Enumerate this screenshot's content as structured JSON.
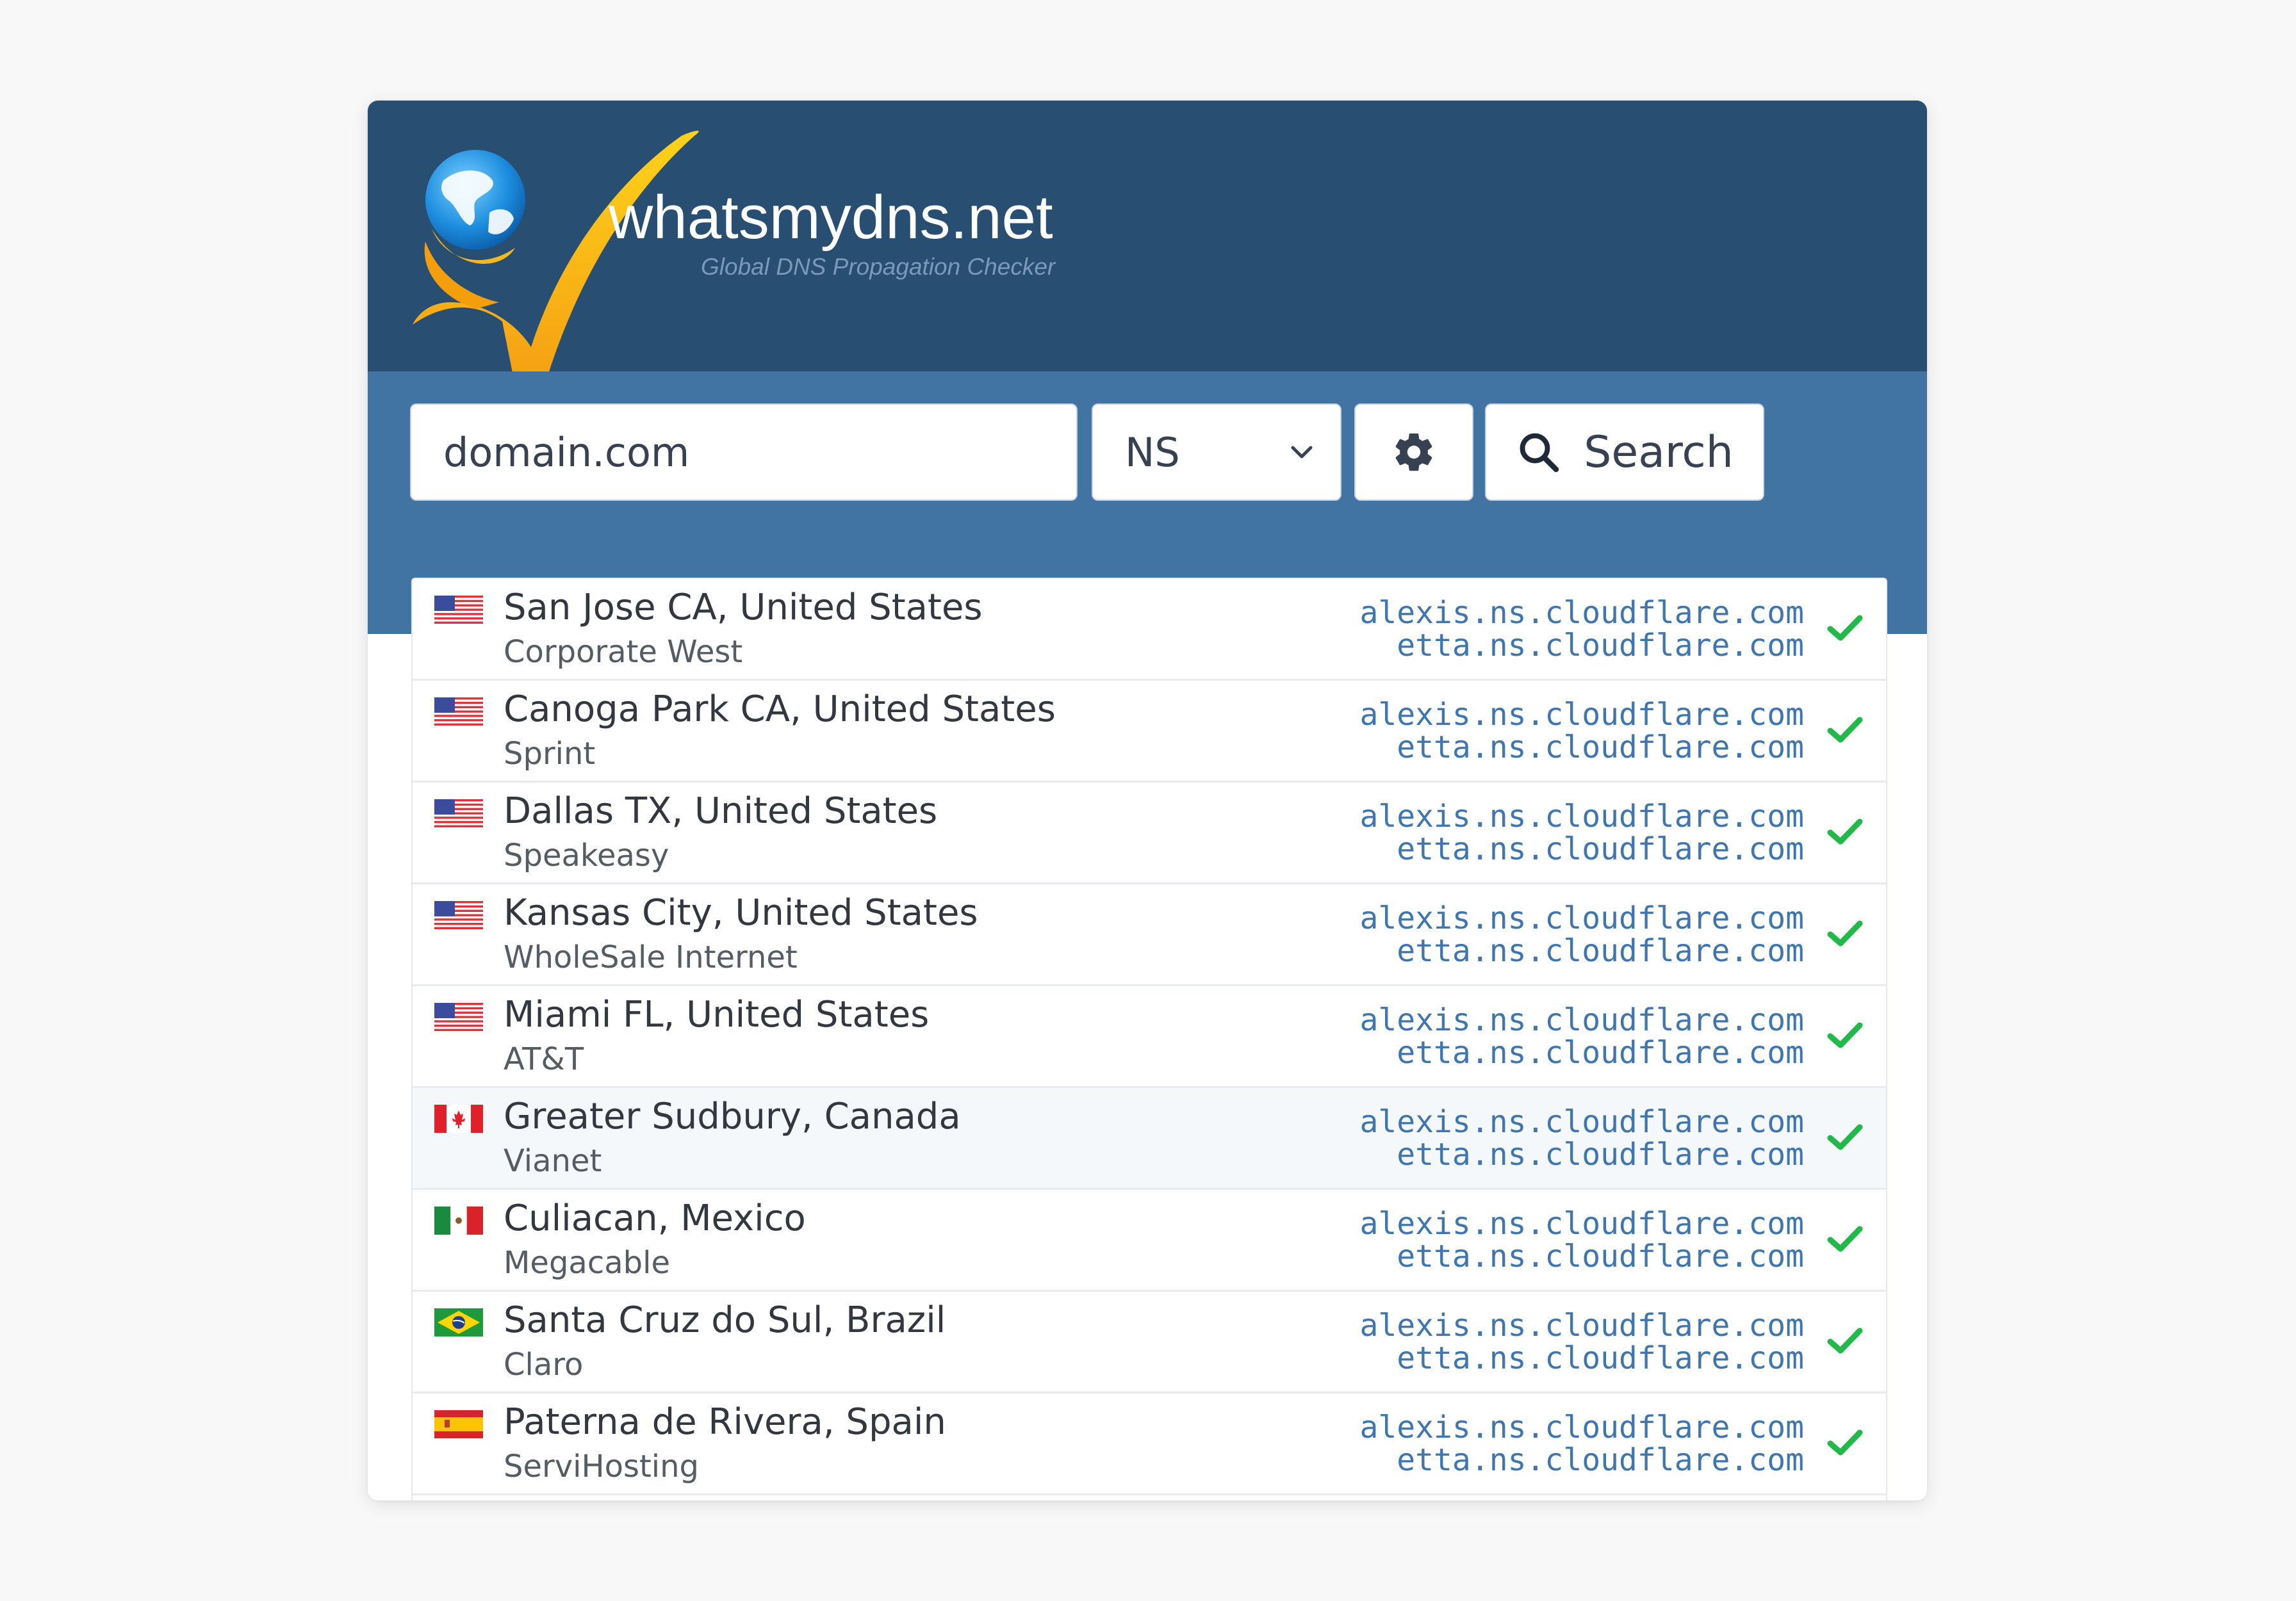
{
  "brand": {
    "name": "whatsmydns.net",
    "tagline": "Global DNS Propagation Checker"
  },
  "search": {
    "value": "domain.com",
    "placeholder": "",
    "record_type": "NS",
    "search_label": "Search"
  },
  "colors": {
    "header": "#284e72",
    "searchbar": "#4173a3",
    "ns_text": "#3f76b0",
    "check": "#22b94a"
  },
  "results": [
    {
      "flag": "us",
      "location": "San Jose CA, United States",
      "provider": "Corporate West",
      "ns1": "alexis.ns.cloudflare.com",
      "ns2": "etta.ns.cloudflare.com",
      "status": "check-icon"
    },
    {
      "flag": "us",
      "location": "Canoga Park CA, United States",
      "provider": "Sprint",
      "ns1": "alexis.ns.cloudflare.com",
      "ns2": "etta.ns.cloudflare.com",
      "status": "check-icon"
    },
    {
      "flag": "us",
      "location": "Dallas TX, United States",
      "provider": "Speakeasy",
      "ns1": "alexis.ns.cloudflare.com",
      "ns2": "etta.ns.cloudflare.com",
      "status": "check-icon"
    },
    {
      "flag": "us",
      "location": "Kansas City, United States",
      "provider": "WholeSale Internet",
      "ns1": "alexis.ns.cloudflare.com",
      "ns2": "etta.ns.cloudflare.com",
      "status": "check-icon"
    },
    {
      "flag": "us",
      "location": "Miami FL, United States",
      "provider": "AT&T",
      "ns1": "alexis.ns.cloudflare.com",
      "ns2": "etta.ns.cloudflare.com",
      "status": "check-icon"
    },
    {
      "flag": "ca",
      "location": "Greater Sudbury, Canada",
      "provider": "Vianet",
      "ns1": "alexis.ns.cloudflare.com",
      "ns2": "etta.ns.cloudflare.com",
      "status": "check-icon"
    },
    {
      "flag": "mx",
      "location": "Culiacan, Mexico",
      "provider": "Megacable",
      "ns1": "alexis.ns.cloudflare.com",
      "ns2": "etta.ns.cloudflare.com",
      "status": "check-icon"
    },
    {
      "flag": "br",
      "location": "Santa Cruz do Sul, Brazil",
      "provider": "Claro",
      "ns1": "alexis.ns.cloudflare.com",
      "ns2": "etta.ns.cloudflare.com",
      "status": "check-icon"
    },
    {
      "flag": "es",
      "location": "Paterna de Rivera, Spain",
      "provider": "ServiHosting",
      "ns1": "alexis.ns.cloudflare.com",
      "ns2": "etta.ns.cloudflare.com",
      "status": "check-icon"
    }
  ]
}
